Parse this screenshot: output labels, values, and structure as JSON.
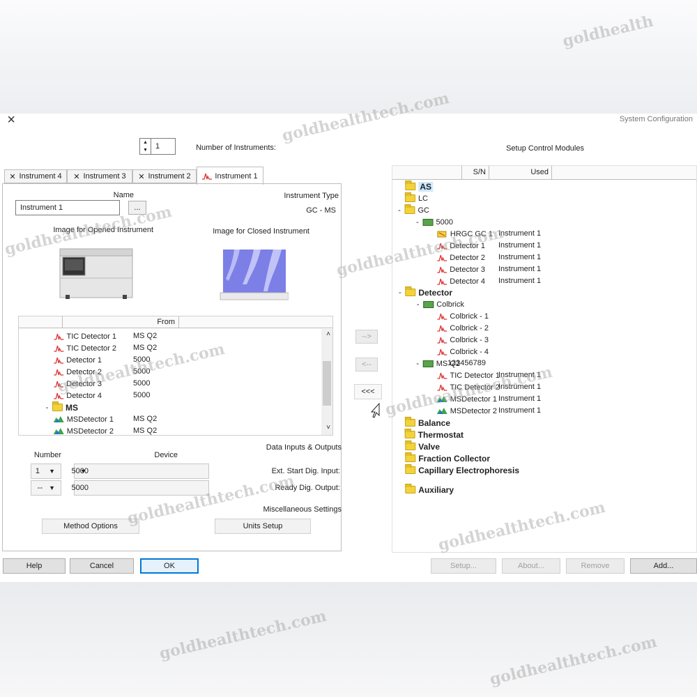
{
  "window": {
    "title": "System Configuration",
    "close_glyph": "×"
  },
  "left_pane": {
    "heading": "Setup Control Modules",
    "columns": [
      "Used",
      "S/N"
    ],
    "tree": [
      {
        "label": "AS",
        "icon": "folder",
        "toggle": "",
        "indent": 0,
        "bold": true,
        "highlight": true
      },
      {
        "label": "LC",
        "icon": "folder",
        "toggle": "",
        "indent": 0
      },
      {
        "label": "GC",
        "icon": "folder",
        "toggle": "-",
        "indent": 0
      },
      {
        "label": "5000",
        "icon": "module-icon",
        "toggle": "-",
        "indent": 1
      },
      {
        "label": "HRGC GC 1",
        "icon": "gc-icon",
        "indent": 2,
        "used": "Instrument 1"
      },
      {
        "label": "Detector 1",
        "icon": "peak",
        "indent": 2,
        "used": "Instrument 1"
      },
      {
        "label": "Detector 2",
        "icon": "peak",
        "indent": 2,
        "used": "Instrument 1"
      },
      {
        "label": "Detector 3",
        "icon": "peak",
        "indent": 2,
        "used": "Instrument 1"
      },
      {
        "label": "Detector 4",
        "icon": "peak",
        "indent": 2,
        "used": "Instrument 1"
      },
      {
        "label": "Detector",
        "icon": "folder",
        "toggle": "-",
        "indent": 0,
        "bold": true
      },
      {
        "label": "Colbrick",
        "icon": "module-icon",
        "toggle": "-",
        "indent": 1
      },
      {
        "label": "Colbrick - 1",
        "icon": "peak",
        "indent": 2
      },
      {
        "label": "Colbrick - 2",
        "icon": "peak",
        "indent": 2
      },
      {
        "label": "Colbrick - 3",
        "icon": "peak",
        "indent": 2
      },
      {
        "label": "Colbrick - 4",
        "icon": "peak",
        "indent": 2
      },
      {
        "label": "MS Q2",
        "icon": "module-icon",
        "toggle": "-",
        "indent": 1,
        "sn": "123456789"
      },
      {
        "label": "TIC Detector 1",
        "icon": "peak",
        "indent": 2,
        "used": "Instrument 1"
      },
      {
        "label": "TIC Detector 2",
        "icon": "peak",
        "indent": 2,
        "used": "Instrument 1"
      },
      {
        "label": "MSDetector 1",
        "icon": "ms-icon",
        "indent": 2,
        "used": "Instrument 1"
      },
      {
        "label": "MSDetector 2",
        "icon": "ms-icon",
        "indent": 2,
        "used": "Instrument 1"
      },
      {
        "label": "Balance",
        "icon": "folder",
        "indent": 0,
        "bold": true
      },
      {
        "label": "Thermostat",
        "icon": "folder",
        "indent": 0,
        "bold": true
      },
      {
        "label": "Valve",
        "icon": "folder",
        "indent": 0,
        "bold": true
      },
      {
        "label": "Fraction Collector",
        "icon": "folder",
        "indent": 0,
        "bold": true
      },
      {
        "label": "Capillary Electrophoresis",
        "icon": "folder",
        "indent": 0,
        "bold": true
      },
      {
        "label": "Auxiliary",
        "icon": "folder",
        "indent": 0,
        "bold": true
      }
    ],
    "buttons": {
      "add": "Add...",
      "remove": "Remove",
      "about": "About...",
      "setup": "Setup..."
    }
  },
  "transfer": {
    "add": "-->",
    "remove": "<--",
    "remove_all": "<<<"
  },
  "right_pane": {
    "number_of_instruments_label": "Number of Instruments:",
    "number_of_instruments_value": "1",
    "tabs": [
      "Instrument 1",
      "Instrument 2",
      "Instrument 3",
      "Instrument 4"
    ],
    "instrument_type_label": "Instrument Type",
    "instrument_type_value": "GC - MS",
    "name_label": "Name",
    "name_value": "Instrument 1",
    "browse_label": "...",
    "closed_image_label": "Image for Closed Instrument",
    "opened_image_label": "Image for Opened Instrument",
    "list_columns": [
      "From"
    ],
    "list_rows": [
      {
        "label": "TIC Detector 1",
        "icon": "peak",
        "from": "MS Q2"
      },
      {
        "label": "TIC Detector 2",
        "icon": "peak",
        "from": "MS Q2"
      },
      {
        "label": "Detector 1",
        "icon": "peak",
        "from": "5000"
      },
      {
        "label": "Detector 2",
        "icon": "peak",
        "from": "5000"
      },
      {
        "label": "Detector 3",
        "icon": "peak",
        "from": "5000"
      },
      {
        "label": "Detector 4",
        "icon": "peak",
        "from": "5000"
      },
      {
        "label": "MS",
        "icon": "folder",
        "toggle": "-",
        "bold": true,
        "from": ""
      },
      {
        "label": "MSDetector 1",
        "icon": "ms-icon",
        "from": "MS Q2"
      },
      {
        "label": "MSDetector 2",
        "icon": "ms-icon",
        "from": "MS Q2"
      }
    ],
    "data_io_label": "Data Inputs & Outputs",
    "device_label": "Device",
    "number_label": "Number",
    "ext_start_label": "Ext. Start Dig. Input:",
    "ext_start_device": "5000",
    "ext_start_number": "1",
    "ready_label": "Ready Dig. Output:",
    "ready_device": "5000",
    "ready_number": "--",
    "misc_label": "Miscellaneous Settings",
    "units_setup": "Units Setup",
    "method_options": "Method Options"
  },
  "footer": {
    "ok": "OK",
    "cancel": "Cancel",
    "help": "Help"
  },
  "watermark": "goldhealthtech.com",
  "watermark_short": "goldhealth",
  "colors": {
    "accent": "#0078d7",
    "folder": "#f3d33b",
    "highlight": "#cde8ff"
  }
}
